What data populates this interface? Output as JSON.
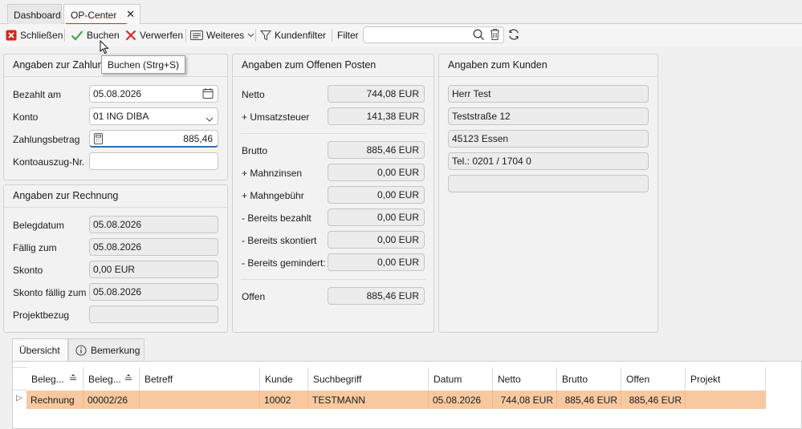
{
  "tabs": [
    {
      "label": "Dashboard",
      "active": false
    },
    {
      "label": "OP-Center",
      "active": true,
      "close": "✕"
    }
  ],
  "toolbar": {
    "close_label": "Schließen",
    "book_label": "Buchen",
    "discard_label": "Verwerfen",
    "more_label": "Weiteres",
    "customer_filter_label": "Kundenfilter",
    "filter_label": "Filter",
    "filter_value": ""
  },
  "tooltip": "Buchen (Strg+S)",
  "colors": {
    "accent_red": "#d9261c",
    "check_green": "#3aa43a",
    "row_highlight": "#f8c9a0"
  },
  "payment": {
    "title": "Angaben zur Zahlung",
    "paid_on_label": "Bezahlt am",
    "paid_on_value": "05.08.2026",
    "account_label": "Konto",
    "account_value": "01 ING DIBA",
    "amount_label": "Zahlungsbetrag",
    "amount_value": "885,46",
    "statement_label": "Kontoauszug-Nr.",
    "statement_value": ""
  },
  "invoice": {
    "title": "Angaben zur Rechnung",
    "doc_date_label": "Belegdatum",
    "doc_date_value": "05.08.2026",
    "due_label": "Fällig zum",
    "due_value": "05.08.2026",
    "discount_label": "Skonto",
    "discount_value": "0,00 EUR",
    "discount_due_label": "Skonto fällig zum",
    "discount_due_value": "05.08.2026",
    "project_label": "Projektbezug",
    "project_value": ""
  },
  "open_item": {
    "title": "Angaben zum Offenen Posten",
    "net_label": "Netto",
    "net_value": "744,08 EUR",
    "vat_label": "+ Umsatzsteuer",
    "vat_value": "141,38 EUR",
    "gross_label": "Brutto",
    "gross_value": "885,46 EUR",
    "interest_label": "+ Mahnzinsen",
    "interest_value": "0,00 EUR",
    "fee_label": "+ Mahngebühr",
    "fee_value": "0,00 EUR",
    "paid_label": "- Bereits bezahlt",
    "paid_value": "0,00 EUR",
    "discounted_label": "- Bereits skontiert",
    "discounted_value": "0,00 EUR",
    "reduced_label": "- Bereits gemindert:",
    "reduced_value": "0,00 EUR",
    "open_label": "Offen",
    "open_value": "885,46 EUR"
  },
  "customer": {
    "title": "Angaben zum Kunden",
    "name": "Herr Test",
    "street": "Teststraße 12",
    "city": "45123 Essen",
    "phone": "Tel.: 0201 / 1704 0",
    "extra": ""
  },
  "lower_tabs": [
    {
      "label": "Übersicht",
      "active": true
    },
    {
      "label": "Bemerkung",
      "active": false,
      "icon": "info-icon"
    }
  ],
  "grid": {
    "columns": [
      "Beleg...",
      "Beleg...",
      "Betreff",
      "Kunde",
      "Suchbegriff",
      "Datum",
      "Netto",
      "Brutto",
      "Offen",
      "Projekt"
    ],
    "row": [
      "Rechnung",
      "00002/26",
      "",
      "10002",
      "TESTMANN",
      "05.08.2026",
      "744,08 EUR",
      "885,46 EUR",
      "885,46 EUR",
      ""
    ],
    "row_marker": "▷"
  }
}
